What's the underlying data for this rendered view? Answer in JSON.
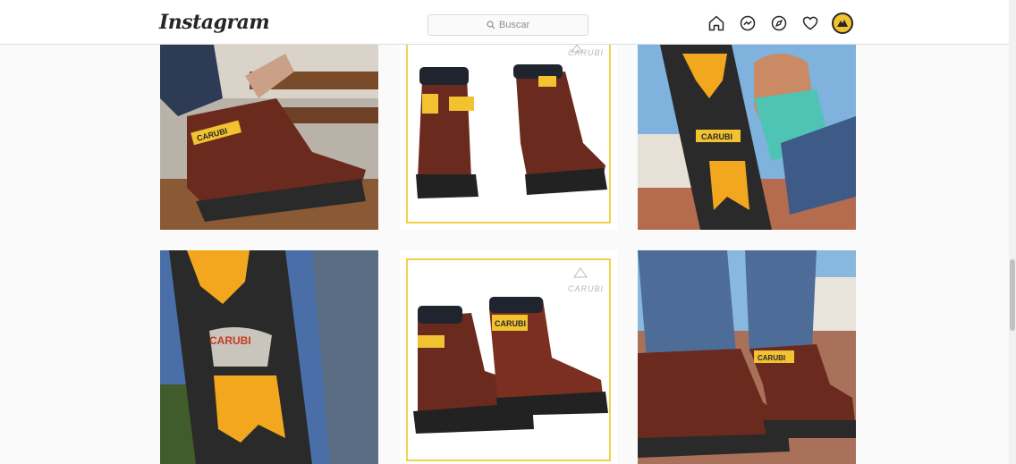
{
  "app": {
    "logo": "Instagram"
  },
  "search": {
    "placeholder": "Buscar"
  },
  "nav": {
    "icons": [
      "home-icon",
      "messenger-icon",
      "explore-icon",
      "activity-heart-icon",
      "profile-avatar"
    ]
  },
  "posts": [
    {
      "alt_icon": "photo",
      "brand_label": "CARUBI"
    },
    {
      "alt_icon": "photo",
      "brand_label": "CARUBI",
      "watermark": "CARUBI"
    },
    {
      "alt_icon": "photo",
      "brand_label": "CARUBI"
    },
    {
      "alt_icon": "photo",
      "brand_label": "CARUBI"
    },
    {
      "alt_icon": "photo",
      "brand_label": "CARUBI",
      "watermark": "CARUBI"
    },
    {
      "alt_icon": "photo",
      "brand_label": "CARUBI"
    }
  ],
  "colors": {
    "accent_yellow": "#f2c230",
    "leather": "#6b2a1e",
    "sole": "#2a2a2a",
    "frame": "#f0d24a"
  }
}
